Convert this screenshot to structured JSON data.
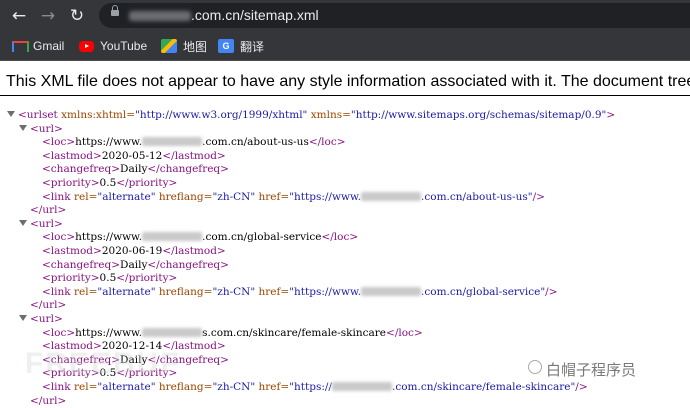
{
  "browser": {
    "url_visible": ".com.cn/sitemap.xml",
    "bookmarks": [
      {
        "label": "Gmail",
        "icon": "gmail-icon"
      },
      {
        "label": "YouTube",
        "icon": "youtube-icon"
      },
      {
        "label": "地图",
        "icon": "maps-icon"
      },
      {
        "label": "翻译",
        "icon": "translate-icon"
      }
    ]
  },
  "xml_notice": "This XML file does not appear to have any style information associated with it. The document tree",
  "code": {
    "urlset_open": "<urlset",
    "urlset_attr1_name": " xmlns:xhtml=",
    "urlset_attr1_value": "\"http://www.w3.org/1999/xhtml\"",
    "urlset_attr2_name": " xmlns=",
    "urlset_attr2_value": "\"http://www.sitemaps.org/schemas/sitemap/0.9\"",
    "urlset_close_bracket": ">",
    "url_open": "<url>",
    "url_close": "</url>",
    "loc_open": "<loc>",
    "loc_close": "</loc>",
    "lastmod_open": "<lastmod>",
    "lastmod_close": "</lastmod>",
    "changefreq_open": "<changefreq>",
    "changefreq_close": "</changefreq>",
    "priority_open": "<priority>",
    "priority_close": "</priority>",
    "link_open": "<link",
    "link_rel_name": " rel=",
    "link_rel_value": "\"alternate\"",
    "link_hreflang_name": " hreflang=",
    "link_hreflang_value": "\"zh-CN\"",
    "link_href_name": " href=",
    "link_end": "/>",
    "loc_prefix": "https://www.",
    "entries": [
      {
        "path": ".com.cn/about-us-us",
        "lastmod": "2020-05-12",
        "changefreq": "Daily",
        "priority": "0.5",
        "href_tail": ".com.cn/about-us-us\""
      },
      {
        "path": ".com.cn/global-service",
        "lastmod": "2020-06-19",
        "changefreq": "Daily",
        "priority": "0.5",
        "href_tail": ".com.cn/global-service\""
      },
      {
        "path": "s.com.cn/skincare/female-skincare",
        "lastmod": "2020-12-14",
        "changefreq": "Daily",
        "priority": "0.5",
        "href_tail": ".com.cn/skincare/female-skincare\""
      }
    ],
    "href_prefix": "\"https://www.",
    "href_prefix_short": "\"https://"
  },
  "watermark": "白帽子程序员",
  "colors": {
    "tag": "#881280",
    "attr_name": "#994500",
    "attr_value": "#1a1aa6",
    "browser_chrome": "#35363a",
    "omnibox": "#202124"
  }
}
